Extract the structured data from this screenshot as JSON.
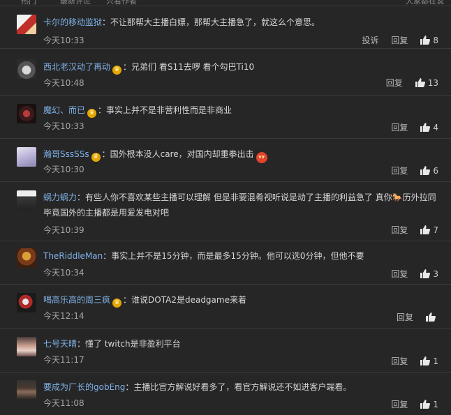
{
  "header": {
    "tabs": [
      "热门",
      "最新评论",
      "只看作者",
      "大家都在说"
    ]
  },
  "actions": {
    "report": "投诉",
    "reply": "回复"
  },
  "colors": {
    "username": "#7fb1e8",
    "background": "#262626"
  },
  "comments": [
    {
      "user": "卡尔的移动监狱",
      "crown": false,
      "text": "不让那帮大主播白嫖，那帮大主播急了，就这么个意思。",
      "time": "今天10:33",
      "likes": "8",
      "show_report": true
    },
    {
      "user": "西北老汉动了再动",
      "crown": true,
      "text": "兄弟们 看S11去啰 看个勾巴Ti10",
      "time": "今天10:48",
      "likes": "13",
      "show_report": false
    },
    {
      "user": "魔幻、而已",
      "crown": true,
      "text": "事实上并不是非营利性而是非商业",
      "time": "今天10:33",
      "likes": "4",
      "show_report": false
    },
    {
      "user": "瀚哥SssSSs",
      "crown": true,
      "text": "国外根本没人care，对国内却重拳出击",
      "time": "今天10:30",
      "likes": "6",
      "show_report": false
    },
    {
      "user": "蜗力蜗力",
      "crown": false,
      "text": "有些人你不喜欢某些主播可以理解 但是非要混肴视听说是动了主播的利益急了 真你",
      "text2": "历外拉同毕竟国外的主播都是用爱发电对吧",
      "time": "今天10:39",
      "likes": "7",
      "show_report": false
    },
    {
      "user": "TheRiddleMan",
      "crown": false,
      "text": "事实上并不是15分钟，而是最多15分钟。他可以选0分钟，但他不要",
      "time": "今天10:34",
      "likes": "3",
      "show_report": false
    },
    {
      "user": "喝高乐高的周三疯",
      "crown": true,
      "text": "谁说DOTA2是deadgame来着",
      "time": "今天12:14",
      "likes": "",
      "show_report": false
    },
    {
      "user": "七号天晴",
      "crown": false,
      "text": "懂了 twitch是非盈利平台",
      "time": "今天11:17",
      "likes": "1",
      "show_report": false
    },
    {
      "user": "要成为厂长的gobEng",
      "crown": false,
      "text": "主播比官方解说好看多了，看官方解说还不如进客户端看。",
      "time": "今天11:08",
      "likes": "1",
      "show_report": false
    }
  ]
}
